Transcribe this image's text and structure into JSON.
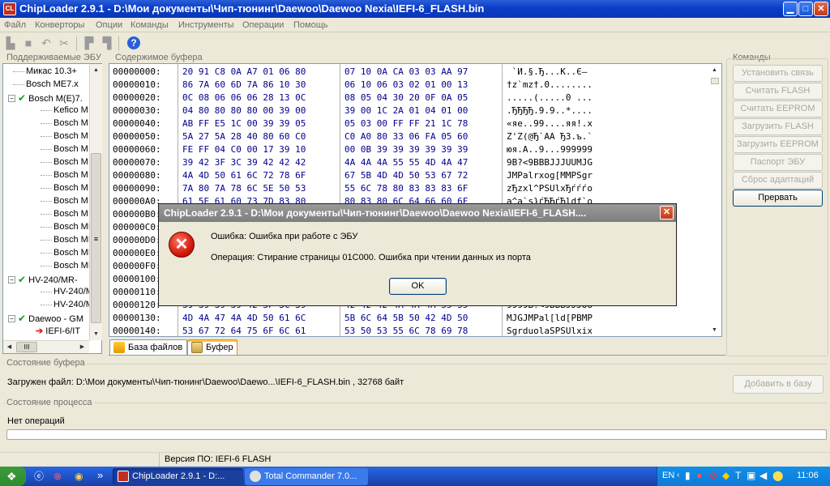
{
  "window": {
    "title": "ChipLoader 2.9.1 - D:\\Мои документы\\Чип-тюнинг\\Daewoo\\Daewoo Nexia\\IEFI-6_FLASH.bin",
    "icon_label": "CL"
  },
  "menu": [
    "Файл",
    "Конверторы",
    "Опции",
    "Команды",
    "Инструменты",
    "Операции",
    "Помощь"
  ],
  "toolbar_icons": [
    "open-icon",
    "save-icon",
    "undo-icon",
    "cut-icon",
    "copy-icon",
    "paste-icon",
    "help-icon"
  ],
  "ecu_panel": {
    "label": "Поддерживаемые ЭБУ",
    "items": [
      {
        "label": "Микас 10.3+"
      },
      {
        "label": "Bosch ME7.x"
      },
      {
        "label": "Bosch M(E)7.",
        "expanded": true
      },
      {
        "label": "Kefico M"
      },
      {
        "label": "Bosch M"
      },
      {
        "label": "Bosch M"
      },
      {
        "label": "Bosch M"
      },
      {
        "label": "Bosch M"
      },
      {
        "label": "Bosch M"
      },
      {
        "label": "Bosch M"
      },
      {
        "label": "Bosch M"
      },
      {
        "label": "Bosch M"
      },
      {
        "label": "Bosch MI"
      },
      {
        "label": "Bosch MI"
      },
      {
        "label": "Bosch MI"
      },
      {
        "label": "Bosch MI"
      },
      {
        "label": "HV-240/MR-",
        "expanded": true
      },
      {
        "label": "HV-240/M"
      },
      {
        "label": "HV-240/M"
      },
      {
        "label": "Daewoo - GM",
        "expanded": true
      },
      {
        "label": "IEFI-6/IT",
        "selected": true
      }
    ],
    "scroll_label": "III"
  },
  "buffer": {
    "label": "Содержимое буфера",
    "rows": [
      {
        "addr": "00000000:",
        "h1": "20 91 C8 0A A7 01 06 80",
        "h2": "07 10 0A CA 03 03 AA 97",
        "ascii": " `И.§.Ђ...К..Є–"
      },
      {
        "addr": "00000010:",
        "h1": "86 7A 60 6D 7A 86 10 30",
        "h2": "06 10 06 03 02 01 00 13",
        "ascii": "†z`mz†.0........"
      },
      {
        "addr": "00000020:",
        "h1": "0C 08 06 06 06 28 13 0C",
        "h2": "08 05 04 30 20 0F 0A 05",
        "ascii": ".....(.....0 ..."
      },
      {
        "addr": "00000030:",
        "h1": "04 80 80 80 80 00 39 00",
        "h2": "39 00 1C 2A 01 04 01 00",
        "ascii": ".ЂЂЂЂ.9.9..*...."
      },
      {
        "addr": "00000040:",
        "h1": "AB FF E5 1C 00 39 39 05",
        "h2": "05 03 00 FF FF 21 1C 78",
        "ascii": "«яе..99....яя!.x"
      },
      {
        "addr": "00000050:",
        "h1": "5A 27 5A 28 40 80 60 C0",
        "h2": "C0 A0 80 33 06 FA 05 60",
        "ascii": "Z'Z(@Ђ`АА Ђ3.ъ.`"
      },
      {
        "addr": "00000060:",
        "h1": "FE FF 04 C0 00 17 39 10",
        "h2": "00 0B 39 39 39 39 39 39",
        "ascii": "юя.А..9...999999"
      },
      {
        "addr": "00000070:",
        "h1": "39 42 3F 3C 39 42 42 42",
        "h2": "4A 4A 4A 55 55 4D 4A 47",
        "ascii": "9B?<9BBBJJJUUMJG"
      },
      {
        "addr": "00000080:",
        "h1": "4A 4D 50 61 6C 72 78 6F",
        "h2": "67 5B 4D 4D 50 53 67 72",
        "ascii": "JMPalrxog[MMPSgr"
      },
      {
        "addr": "00000090:",
        "h1": "7A 80 7A 78 6C 5E 50 53",
        "h2": "55 6C 78 80 83 83 83 6F",
        "ascii": "zЂzxl^PSUlxЂѓѓѓo"
      },
      {
        "addr": "000000A0:",
        "h1": "61 5E 61 60 73 7D 83 80",
        "h2": "80 83 80 6C 64 66 60 6F",
        "ascii": "a^a`s}ѓЂЂѓЂldf`o"
      },
      {
        "addr": "000000B0:",
        "h1": "",
        "h2": "",
        "ascii": ""
      },
      {
        "addr": "000000C0:",
        "h1": "",
        "h2": "",
        "ascii": ""
      },
      {
        "addr": "000000D0:",
        "h1": "",
        "h2": "",
        "ascii": ""
      },
      {
        "addr": "000000E0:",
        "h1": "",
        "h2": "",
        "ascii": ""
      },
      {
        "addr": "000000F0:",
        "h1": "",
        "h2": "",
        "ascii": ""
      },
      {
        "addr": "00000100:",
        "h1": "",
        "h2": "",
        "ascii": ""
      },
      {
        "addr": "00000110:",
        "h1": "",
        "h2": "",
        "ascii": ""
      },
      {
        "addr": "00000120:",
        "h1": "39 39 39 39 42 3F 3C 39",
        "h2": "42 42 42 4A 4A 4A 55 55",
        "ascii": "9999B?<9BBBJJJUU"
      },
      {
        "addr": "00000130:",
        "h1": "4D 4A 47 4A 4D 50 61 6C",
        "h2": "5B 6C 64 5B 50 42 4D 50",
        "ascii": "MJGJMPal[ld[PBMP"
      },
      {
        "addr": "00000140:",
        "h1": "53 67 72 64 75 6F 6C 61",
        "h2": "53 50 53 55 6C 78 69 78",
        "ascii": "SgrduolaSPSUlxix"
      }
    ]
  },
  "tabs": [
    {
      "label": "База файлов"
    },
    {
      "label": "Буфер",
      "active": true
    }
  ],
  "commands": {
    "label": "Команды",
    "buttons": [
      {
        "label": "Установить связь",
        "enabled": false
      },
      {
        "label": "Считать FLASH",
        "enabled": false
      },
      {
        "label": "Считать EEPROM",
        "enabled": false
      },
      {
        "label": "Загрузить FLASH",
        "enabled": false
      },
      {
        "label": "Загрузить EEPROM",
        "enabled": false
      },
      {
        "label": "Паспорт ЭБУ",
        "enabled": false
      },
      {
        "label": "Сброс адаптаций",
        "enabled": false
      },
      {
        "label": "Прервать",
        "enabled": true
      }
    ]
  },
  "buffer_state": {
    "label": "Состояние буфера",
    "text": "Загружен файл: D:\\Мои документы\\Чип-тюнинг\\Daewoo\\Daewo...\\IEFI-6_FLASH.bin , 32768 байт",
    "add_button": "Добавить в базу"
  },
  "process_state": {
    "label": "Состояние процесса",
    "text": "Нет операций",
    "progress": 0
  },
  "statusbar": {
    "version": "Версия ПО: IEFI-6 FLASH"
  },
  "dialog": {
    "title": "ChipLoader 2.9.1 - D:\\Мои документы\\Чип-тюнинг\\Daewoo\\Daewoo Nexia\\IEFI-6_FLASH....",
    "line1": "Ошибка: Ошибка при работе с ЭБУ",
    "line2": "Операция: Стирание страницы 01C000. Ошибка при чтении данных из порта",
    "ok": "OK"
  },
  "taskbar": {
    "chevron": "»",
    "tasks": [
      {
        "label": "ChipLoader 2.9.1 - D:...",
        "active": true
      },
      {
        "label": "Total Commander 7.0...",
        "active": false
      }
    ],
    "lang": "EN",
    "clock": "11:06"
  },
  "colors": {
    "titlebar": "#0a3cc8",
    "hex_text": "#00008b",
    "error_red": "#d21a0a",
    "taskbar": "#245edb",
    "dialog_title_inactive": "#8a8a8a"
  }
}
